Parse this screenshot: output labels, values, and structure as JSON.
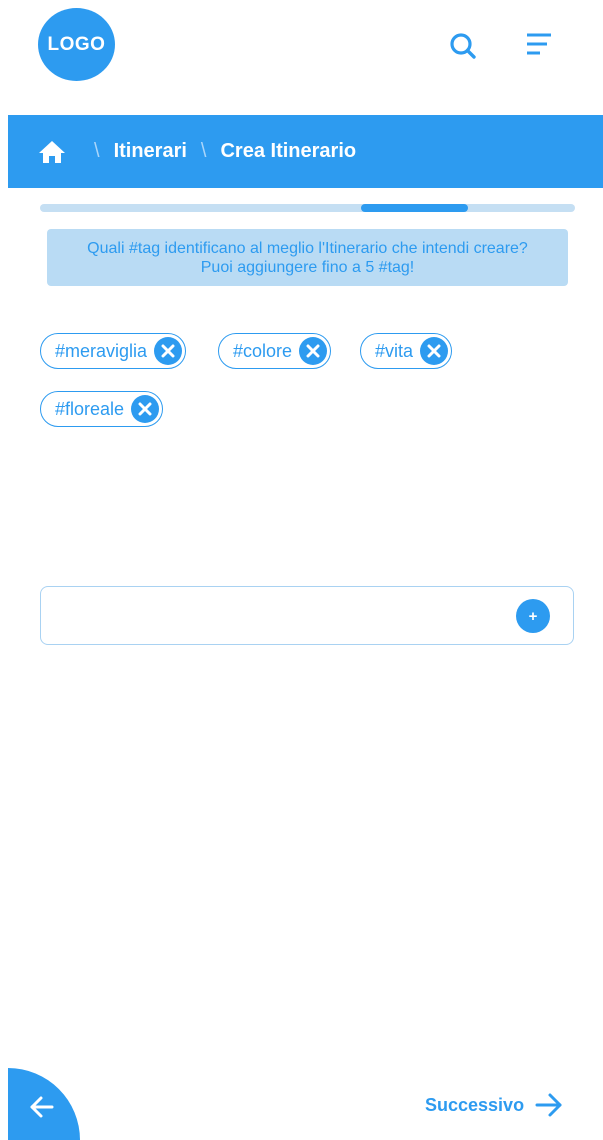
{
  "header": {
    "logo_text": "LOGO",
    "search_icon": "search-icon",
    "menu_icon": "menu-icon"
  },
  "breadcrumb": {
    "home_icon": "home-icon",
    "separator": "\\",
    "items": [
      "Itinerari",
      "Crea Itinerario"
    ]
  },
  "progress": {
    "current_step_fraction_start": 0.6,
    "current_step_fraction_end": 0.8
  },
  "info": {
    "line1": "Quali #tag identificano al meglio l'Itinerario che intendi creare?",
    "line2": "Puoi aggiungere fino a 5 #tag!"
  },
  "tags": [
    {
      "label": "#meraviglia",
      "remove_icon": "close-circle-icon"
    },
    {
      "label": "#colore",
      "remove_icon": "close-circle-icon"
    },
    {
      "label": "#vita",
      "remove_icon": "close-circle-icon"
    },
    {
      "label": "#floreale",
      "remove_icon": "close-circle-icon"
    }
  ],
  "tag_input": {
    "value": "",
    "placeholder": "",
    "add_label": "+"
  },
  "footer": {
    "back_icon": "arrow-left-icon",
    "next_label": "Successivo",
    "next_icon": "arrow-right-icon"
  },
  "colors": {
    "accent": "#2d9bf0",
    "info_bg": "#b9dbf4",
    "progress_track": "#c5dff3"
  }
}
